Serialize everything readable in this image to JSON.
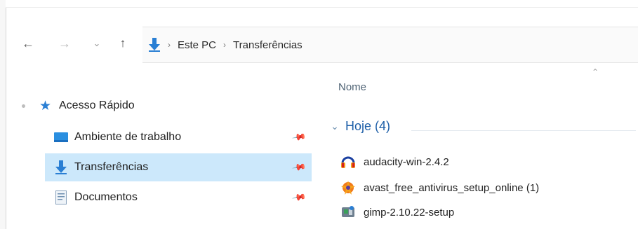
{
  "navigation": {
    "back_icon": "←",
    "forward_icon": "→",
    "recent_icon": "⌄",
    "up_icon": "↑"
  },
  "address_bar": {
    "location_icon": "download-arrow-icon",
    "crumbs": [
      "Este PC",
      "Transferências"
    ],
    "separator": "›"
  },
  "nav_pane": {
    "quick_access_label": "Acesso Rápido",
    "items": [
      {
        "label": "Ambiente de trabalho",
        "icon": "desktop-icon",
        "pinned": true,
        "selected": false
      },
      {
        "label": "Transferências",
        "icon": "download-arrow-icon",
        "pinned": true,
        "selected": true
      },
      {
        "label": "Documentos",
        "icon": "document-icon",
        "pinned": true,
        "selected": false
      }
    ],
    "pin_glyph": "📌"
  },
  "file_list": {
    "column_header": "Nome",
    "group_label": "Hoje (4)",
    "files": [
      {
        "name": "audacity-win-2.4.2",
        "icon": "audacity-icon"
      },
      {
        "name": "avast_free_antivirus_setup_online (1)",
        "icon": "avast-icon"
      },
      {
        "name": "gimp-2.10.22-setup",
        "icon": "gimp-icon"
      }
    ]
  },
  "colors": {
    "accent": "#2a7fd4",
    "selection": "#cce8fb",
    "group_text": "#1e5fa8"
  }
}
